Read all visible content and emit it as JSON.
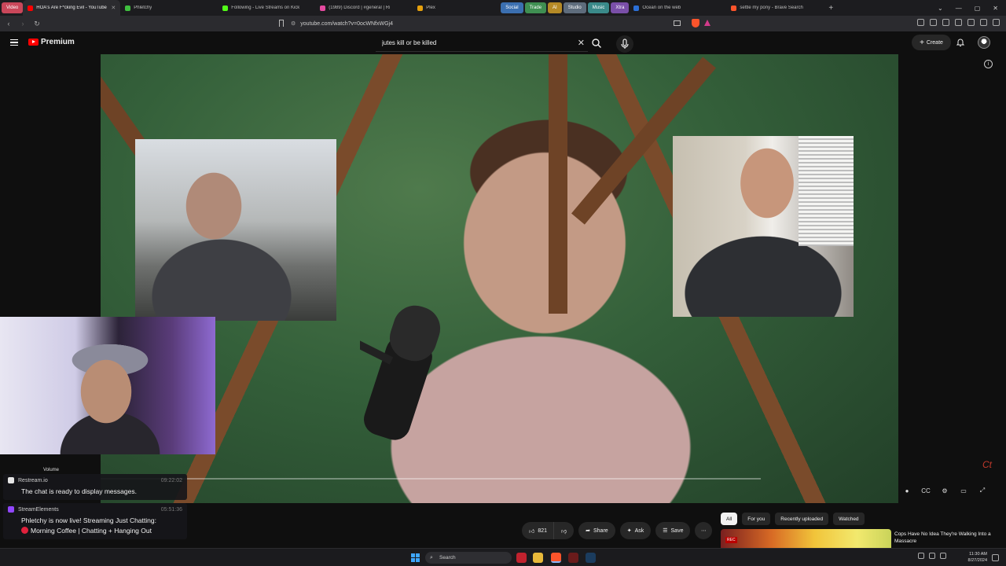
{
  "browser": {
    "groups": [
      {
        "label": "Video",
        "color": "#c9475a"
      },
      {
        "label": "Social",
        "color": "#3b6fb0"
      },
      {
        "label": "Trade",
        "color": "#3f8f52"
      },
      {
        "label": "AI",
        "color": "#b58a26"
      },
      {
        "label": "Studio",
        "color": "#5e6c7c"
      },
      {
        "label": "Music",
        "color": "#3a8a8a"
      },
      {
        "label": "Xtra",
        "color": "#7a4fa8"
      }
    ],
    "tabs": [
      {
        "title": "HOA's Are F*cking Evil - YouTube",
        "color": "#ff0000",
        "active": true
      },
      {
        "title": "Phletchy",
        "color": "#3fbf3f"
      },
      {
        "title": "Following - Live Streams on Kick",
        "color": "#53fc18"
      },
      {
        "title": "(1989) Discord | #general | Ri",
        "color": "#e44aa0"
      },
      {
        "title": "Plex",
        "color": "#e5a00d"
      },
      {
        "title": "Ocean on the web",
        "color": "#2b6fd6"
      },
      {
        "title": "settle my pony - Brave Search",
        "color": "#fb542b"
      }
    ],
    "url": "youtube.com/watch?v=0ocWNfxWGj4"
  },
  "youtube": {
    "brand": "Premium",
    "search_value": "jutes kill or be killed",
    "create_label": "Create"
  },
  "video": {
    "progress_fraction": 0.0
  },
  "webcam": {
    "label": "Volume"
  },
  "chat": {
    "messages": [
      {
        "source": "Restream.io",
        "time": "09:22:02",
        "text": "The chat is ready to display messages.",
        "badge_color": "#e6e6e6"
      },
      {
        "source": "StreamElements",
        "time": "05:51:36",
        "text_line1": "Phletchy is now live! Streaming Just Chatting:",
        "text_line2": "Morning Coffee | Chatting + Hanging Out",
        "badge_color": "#9146ff"
      }
    ]
  },
  "actions": {
    "like_count": "821",
    "share": "Share",
    "ask": "Ask",
    "save": "Save"
  },
  "chips": [
    "All",
    "For you",
    "Recently uploaded",
    "Watched"
  ],
  "recommendation": {
    "title": "Cops Have No Idea They're Walking Into a Massacre",
    "tag": "REC"
  },
  "taskbar": {
    "search_label": "Search",
    "time": "11:30 AM",
    "date": "8/27/2024"
  }
}
